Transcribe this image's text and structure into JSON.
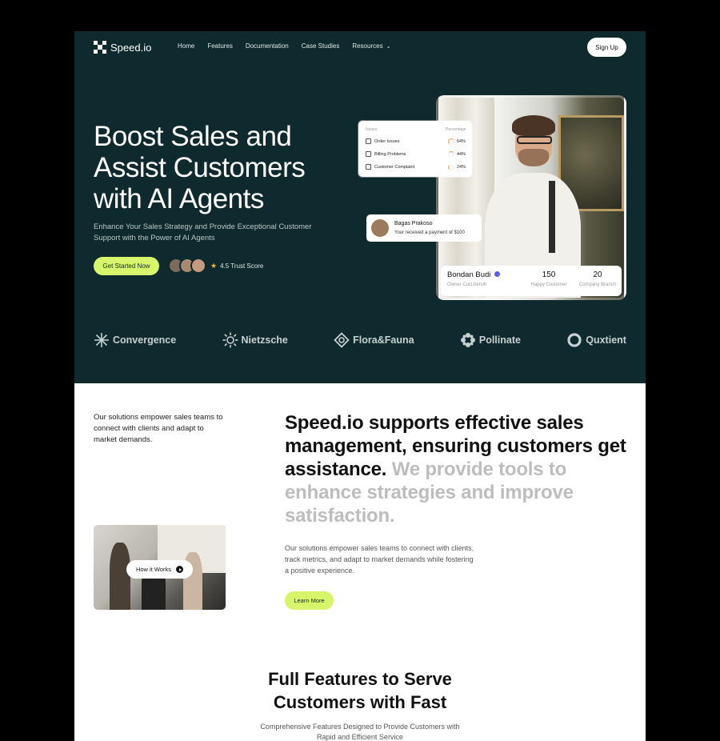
{
  "nav": {
    "logo": "Speed.io",
    "links": [
      "Home",
      "Features",
      "Documentation",
      "Case Studies",
      "Resources"
    ],
    "signup": "Sign Up"
  },
  "hero": {
    "title": "Boost Sales and Assist Customers with AI Agents",
    "subtitle": "Enhance Your Sales Strategy and Provide Exceptional Customer Support with the Power of AI Agents",
    "cta": "Get Started Now",
    "trust": "4.5 Trust Score"
  },
  "issues_card": {
    "header_left": "Issues",
    "header_right": "Percentage",
    "rows": [
      {
        "label": "Order Issues",
        "pct": "64%"
      },
      {
        "label": "Billing Problems",
        "pct": "44%"
      },
      {
        "label": "Customer Complaint",
        "pct": "24%"
      }
    ]
  },
  "payment_card": {
    "name": "Bagas Prakoso",
    "message": "Your received a payment of $100"
  },
  "profile_card": {
    "name": "Bondan Budi",
    "role": "Owner Cuci.bersih",
    "stats": [
      {
        "value": "150",
        "label": "Happy Customer"
      },
      {
        "value": "20",
        "label": "Company Branch"
      }
    ]
  },
  "partners": [
    "Convergence",
    "Nietzsche",
    "Flora&Fauna",
    "Pollinate",
    "Quxtient"
  ],
  "about": {
    "intro": "Our solutions empower sales teams to connect with clients and adapt to market demands.",
    "headline_dark": "Speed.io supports effective sales management, ensuring customers get assistance.",
    "headline_muted": " We provide tools to enhance strategies and improve satisfaction.",
    "video_button": "How it Works",
    "description": "Our solutions empower sales teams to connect with clients, track metrics, and adapt to market demands while fostering a positive experience.",
    "learn_more": "Learn More"
  },
  "features": {
    "title": "Full Features to Serve Customers with Fast",
    "subtitle": "Comprehensive Features Designed to Provide Customers with Rapid and Efficient Service"
  },
  "colors": {
    "hero_bg": "#0e2a2e",
    "accent": "#d6f56a"
  }
}
